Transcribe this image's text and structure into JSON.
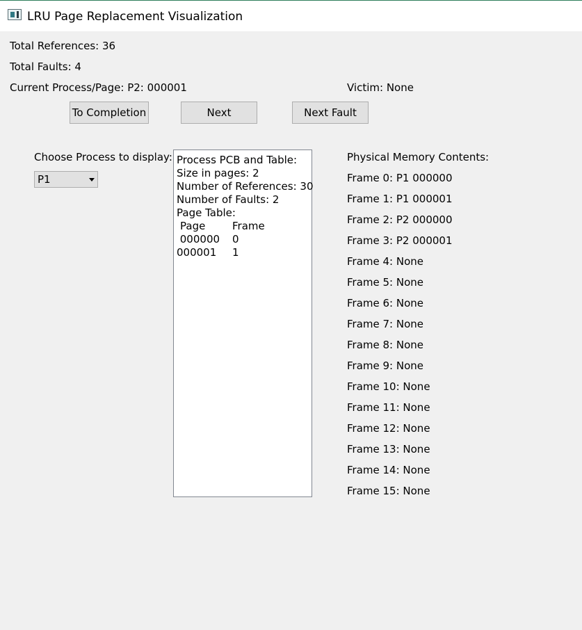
{
  "window": {
    "title": "LRU Page Replacement Visualization"
  },
  "stats": {
    "total_references": "Total References: 36",
    "total_faults": "Total Faults: 4",
    "current": "Current Process/Page: P2: 000001",
    "victim": "Victim: None"
  },
  "buttons": {
    "to_completion": "To Completion",
    "next": "Next",
    "next_fault": "Next Fault"
  },
  "process_select": {
    "label": "Choose Process to display:",
    "selected": "P1"
  },
  "pcb": {
    "heading": "Process PCB and Table:",
    "size": "Size in pages: 2",
    "references": "Number of References: 30",
    "faults": "Number of Faults: 2",
    "table_label": "Page Table:",
    "col_page": "Page",
    "col_frame": "Frame",
    "rows": [
      {
        "page": " 000000",
        "frame": "0"
      },
      {
        "page": "000001",
        "frame": "1"
      }
    ]
  },
  "memory": {
    "heading": "Physical Memory Contents:",
    "frames": [
      "Frame 0: P1 000000",
      "Frame 1: P1 000001",
      "Frame 2: P2 000000",
      "Frame 3: P2 000001",
      "Frame 4: None",
      "Frame 5: None",
      "Frame 6: None",
      "Frame 7: None",
      "Frame 8: None",
      "Frame 9: None",
      "Frame 10: None",
      "Frame 11: None",
      "Frame 12: None",
      "Frame 13: None",
      "Frame 14: None",
      "Frame 15: None"
    ]
  }
}
